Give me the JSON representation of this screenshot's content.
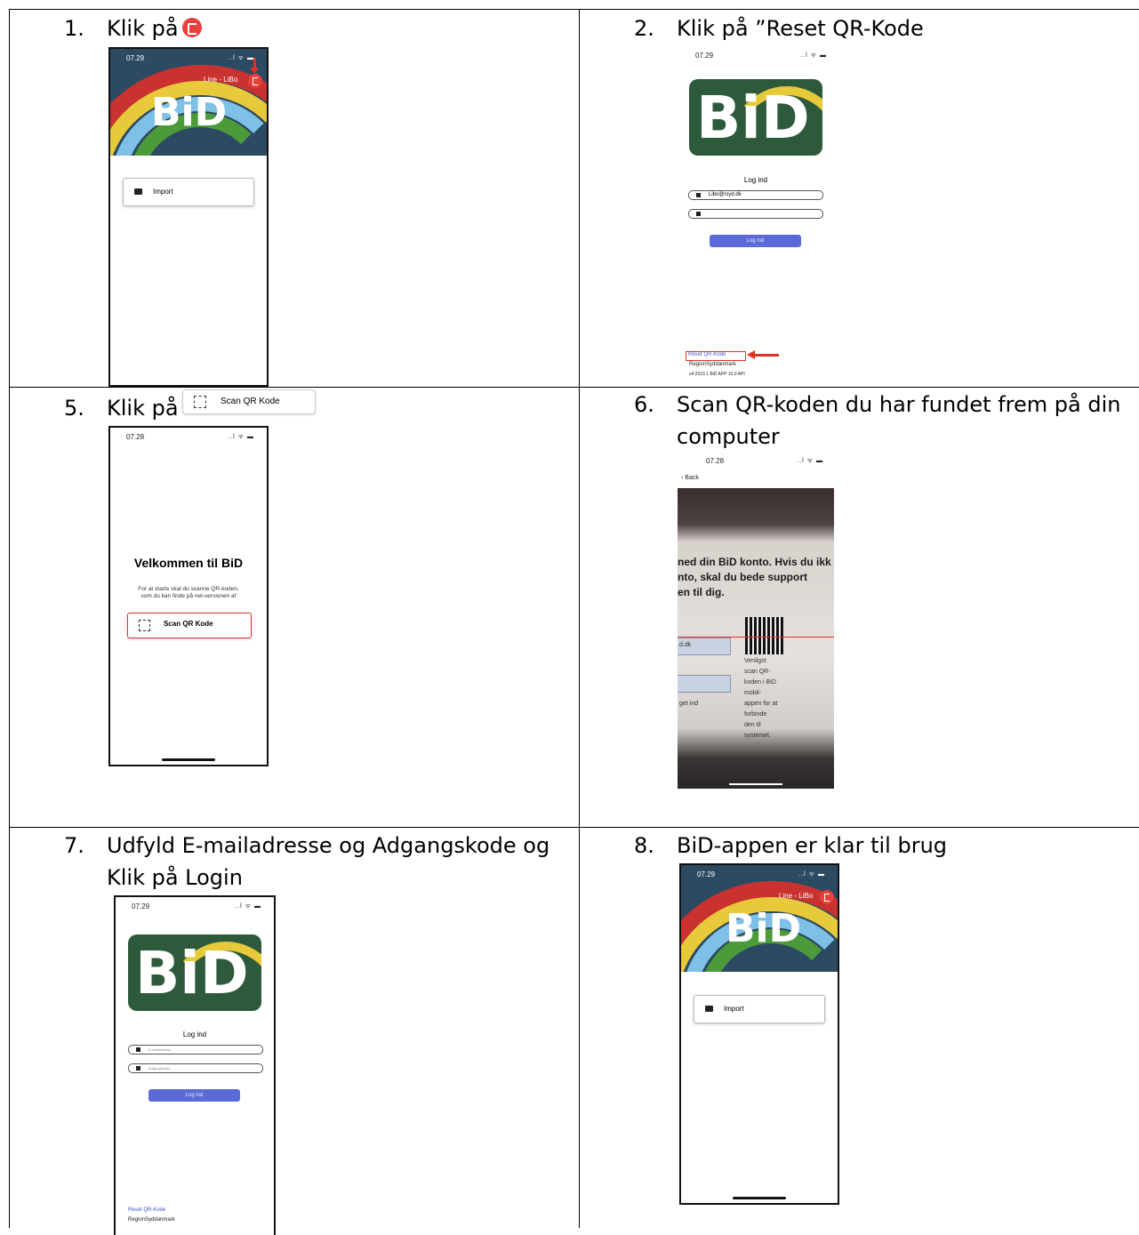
{
  "steps": [
    {
      "num": "1.",
      "text": "Klik på"
    },
    {
      "num": "2.",
      "text": "Klik på ”Reset QR-Kode"
    },
    {
      "num": "5.",
      "text": "Klik på"
    },
    {
      "num": "6.",
      "text": "Scan QR-koden du har fundet frem på din computer"
    },
    {
      "num": "7.",
      "text": "Udfyld E-mailadresse og Adgangskode og Klik på Login"
    },
    {
      "num": "8.",
      "text": "BiD-appen er klar til brug"
    }
  ],
  "inline_scan_chip": "Scan QR Kode",
  "phone": {
    "time_a": "07.29",
    "time_b": "07.28",
    "status_icons": "..l ᯤ ▬",
    "user_label": "Line - LiBo",
    "bid": "BiD",
    "import_label": "Import",
    "login_title": "Log ind",
    "email_value": "Libo@rsyd.dk",
    "email_placeholder": "E-mailadresse",
    "password_placeholder": "Adgangskode",
    "login_button": "Log ind",
    "reset_link": "Reset QR-Kode",
    "region": "RegionSyddanmark",
    "footer": "v4.2023.1 BiD APP 10.0 API",
    "welcome_title": "Velkommen til BiD",
    "welcome_text_1": "For at starte skal du scanne QR-koden,",
    "welcome_text_2": "som du kan finde på net-versionen af",
    "scan_button": "Scan QR Kode",
    "back": "Back",
    "photo_line_1": "ned din BiD konto. Hvis du ikk",
    "photo_line_2": "nto, skal du bede support",
    "photo_line_3": "en til dig.",
    "photo_input": "d.dk",
    "photo_login": "get ind",
    "photo_side_text": [
      "Venligst",
      "scan QR-",
      "koden i BiD",
      "mobil-",
      "appen for at",
      "forbinde",
      "den til",
      "systemet."
    ]
  },
  "colors": {
    "accent_red": "#e8413b",
    "login_blue": "#5a6ad6",
    "bid_green": "#2d5a3a"
  }
}
